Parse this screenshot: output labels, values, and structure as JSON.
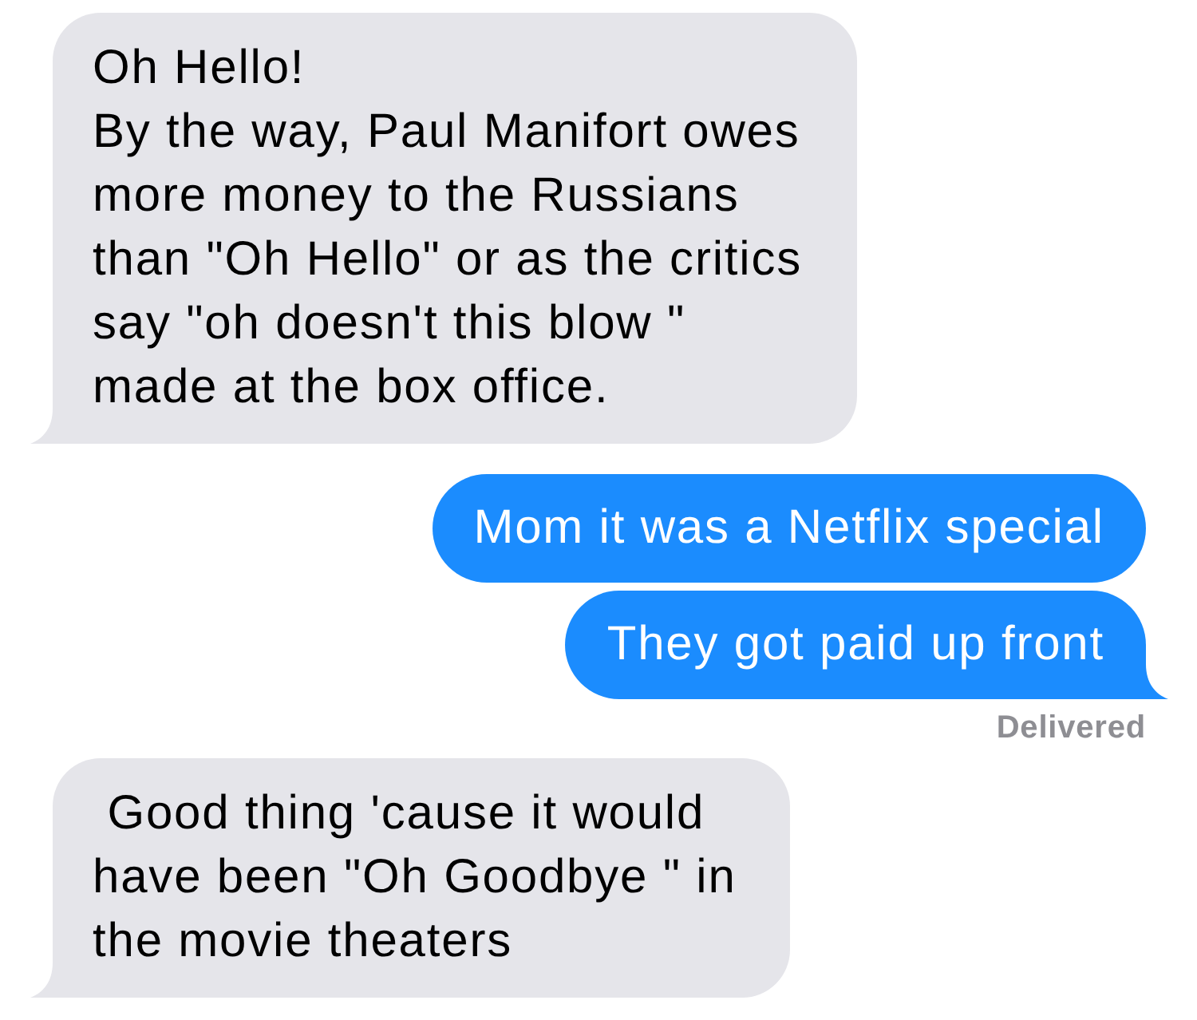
{
  "messages": [
    {
      "kind": "received",
      "text": "Oh Hello!\nBy the way, Paul Manifort owes\nmore money to the Russians\nthan \"Oh Hello\" or as the critics\nsay \"oh doesn't this blow \"\nmade at the box office.",
      "tail": true
    },
    {
      "kind": "sent",
      "text": "Mom it was a Netflix special",
      "tail": false
    },
    {
      "kind": "sent",
      "text": "They got paid up front",
      "tail": true,
      "receipt": "Delivered"
    },
    {
      "kind": "received",
      "text": " Good thing 'cause it would\nhave been \"Oh Goodbye \" in\nthe movie theaters",
      "tail": true
    }
  ]
}
